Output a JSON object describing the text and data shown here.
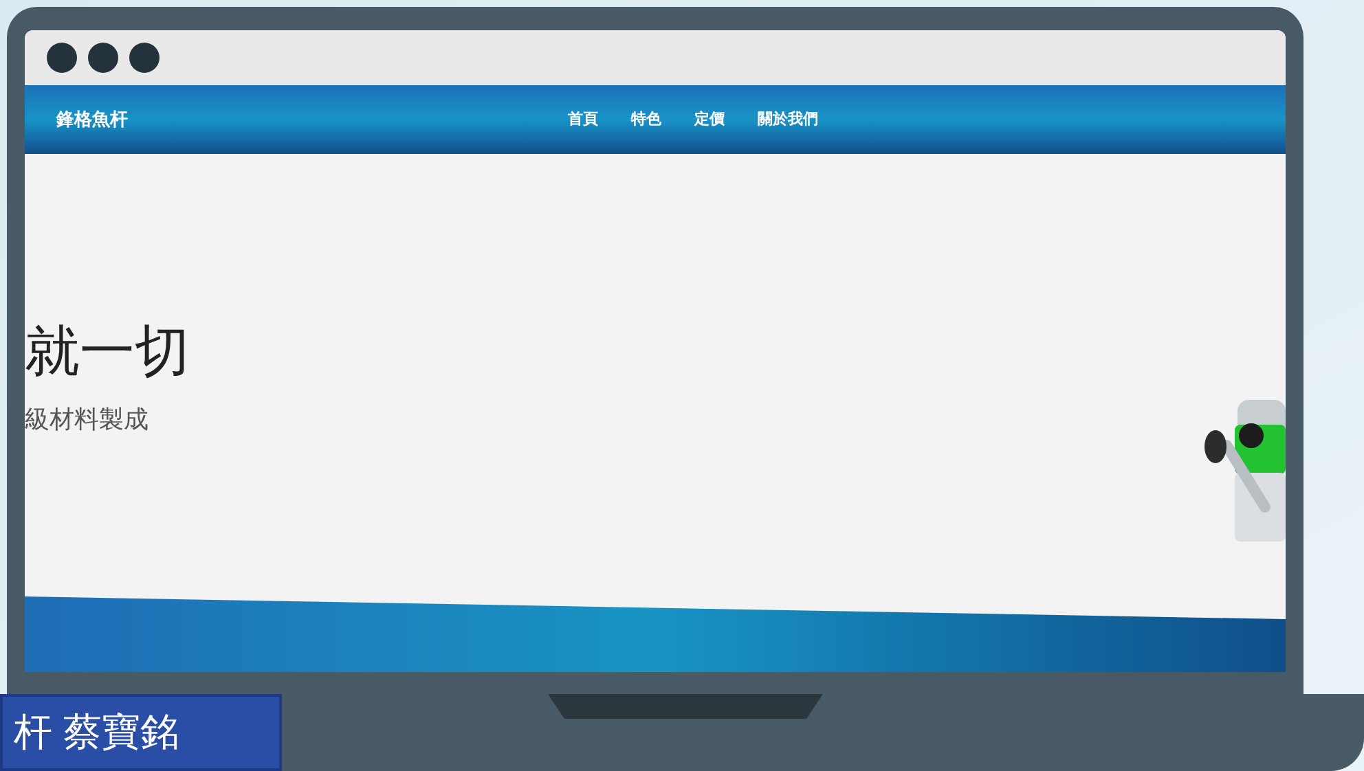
{
  "site": {
    "brand": "鋒格魚杆",
    "nav": [
      {
        "label": "首頁"
      },
      {
        "label": "特色"
      },
      {
        "label": "定價"
      },
      {
        "label": "關於我們"
      }
    ],
    "hero": {
      "headline": "就一切",
      "subtitle": "級材料製成"
    }
  },
  "caption": "杆 蔡寶銘"
}
